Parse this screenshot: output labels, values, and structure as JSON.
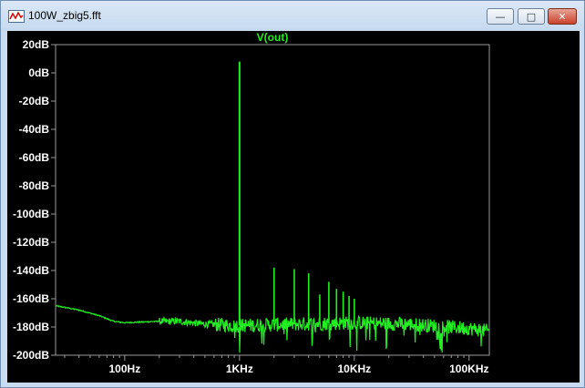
{
  "window": {
    "title": "100W_zbig5.fft",
    "buttons": {
      "minimize": "—",
      "maximize": "□",
      "close": "✕"
    },
    "icon": "waveform-app-icon"
  },
  "chart_data": {
    "type": "line",
    "title": "V(out)",
    "xscale": "log",
    "xlim": [
      25,
      150000
    ],
    "ylim": [
      -200,
      20
    ],
    "grid": false,
    "trace_color": "#22ee22",
    "yticks": [
      {
        "value": 20,
        "label": "20dB"
      },
      {
        "value": 0,
        "label": "0dB"
      },
      {
        "value": -20,
        "label": "-20dB"
      },
      {
        "value": -40,
        "label": "-40dB"
      },
      {
        "value": -60,
        "label": "-60dB"
      },
      {
        "value": -80,
        "label": "-80dB"
      },
      {
        "value": -100,
        "label": "-100dB"
      },
      {
        "value": -120,
        "label": "-120dB"
      },
      {
        "value": -140,
        "label": "-140dB"
      },
      {
        "value": -160,
        "label": "-160dB"
      },
      {
        "value": -180,
        "label": "-180dB"
      },
      {
        "value": -200,
        "label": "-200dB"
      }
    ],
    "xticks": [
      {
        "value": 100,
        "label": "100Hz"
      },
      {
        "value": 1000,
        "label": "1KHz"
      },
      {
        "value": 10000,
        "label": "10KHz"
      },
      {
        "value": 100000,
        "label": "100KHz"
      }
    ],
    "noise_floor": [
      [
        25,
        -165
      ],
      [
        40,
        -168
      ],
      [
        60,
        -172
      ],
      [
        80,
        -176
      ],
      [
        100,
        -177
      ],
      [
        200,
        -176
      ],
      [
        300,
        -176
      ],
      [
        500,
        -178
      ],
      [
        1000,
        -179
      ],
      [
        3000,
        -178
      ],
      [
        10000,
        -177
      ],
      [
        30000,
        -178
      ],
      [
        100000,
        -181
      ],
      [
        150000,
        -183
      ]
    ],
    "peaks": [
      {
        "x": 1000,
        "y": 8
      },
      {
        "x": 2000,
        "y": -138
      },
      {
        "x": 3000,
        "y": -139
      },
      {
        "x": 4000,
        "y": -142
      },
      {
        "x": 5000,
        "y": -157
      },
      {
        "x": 6000,
        "y": -148
      },
      {
        "x": 7000,
        "y": -153
      },
      {
        "x": 8000,
        "y": -155
      },
      {
        "x": 9000,
        "y": -158
      },
      {
        "x": 10000,
        "y": -160
      }
    ]
  }
}
